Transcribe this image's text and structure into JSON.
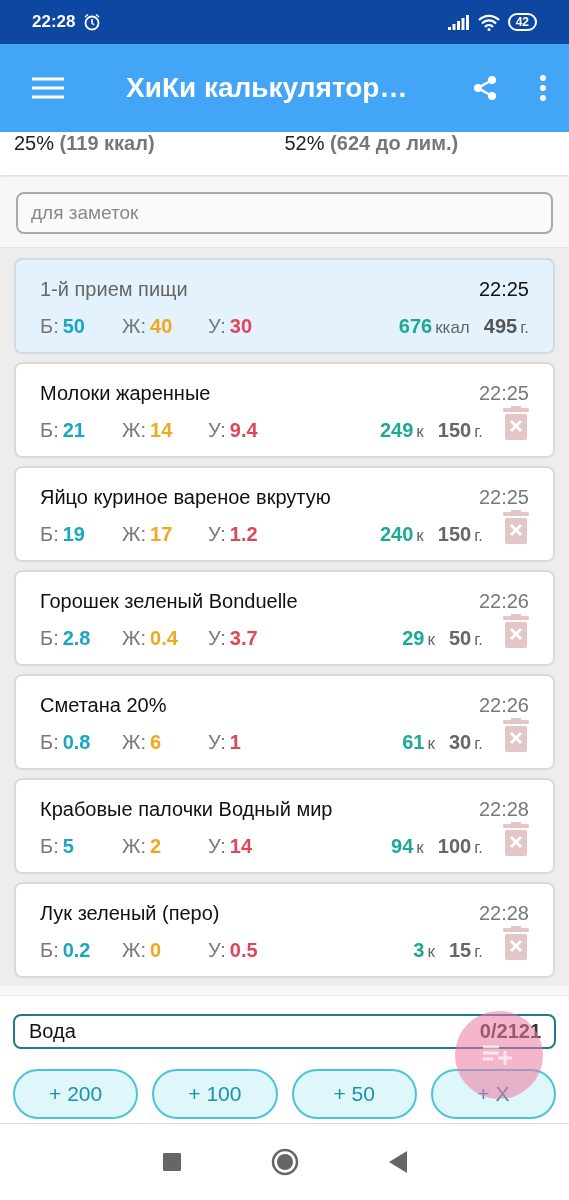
{
  "status_bar": {
    "time": "22:28",
    "battery": "42"
  },
  "app_bar": {
    "title": "ХиКи калькулятор…"
  },
  "summary": [
    {
      "percent": "25%",
      "detail": "(119 ккал)"
    },
    {
      "percent": "52%",
      "detail": "(624 до лим.)"
    }
  ],
  "notes": {
    "placeholder": "для заметок"
  },
  "meal": {
    "name": "1-й прием пищи",
    "time": "22:25",
    "macros": [
      {
        "kind": "protein",
        "label": "Б:",
        "value": "50"
      },
      {
        "kind": "fat",
        "label": "Ж:",
        "value": "40"
      },
      {
        "kind": "carbs",
        "label": "У:",
        "value": "30"
      }
    ],
    "kcal": "676",
    "kcal_unit": "ккал",
    "weight": "495",
    "weight_unit": "г."
  },
  "foods": [
    {
      "name": "Молоки жаренные",
      "time": "22:25",
      "macros": [
        {
          "kind": "protein",
          "label": "Б:",
          "value": "21"
        },
        {
          "kind": "fat",
          "label": "Ж:",
          "value": "14"
        },
        {
          "kind": "carbs",
          "label": "У:",
          "value": "9.4"
        }
      ],
      "kcal": "249",
      "kcal_unit": "к",
      "weight": "150",
      "weight_unit": "г."
    },
    {
      "name": "Яйцо куриное вареное вкрутую",
      "time": "22:25",
      "macros": [
        {
          "kind": "protein",
          "label": "Б:",
          "value": "19"
        },
        {
          "kind": "fat",
          "label": "Ж:",
          "value": "17"
        },
        {
          "kind": "carbs",
          "label": "У:",
          "value": "1.2"
        }
      ],
      "kcal": "240",
      "kcal_unit": "к",
      "weight": "150",
      "weight_unit": "г."
    },
    {
      "name": "Горошек зеленый Bonduelle",
      "time": "22:26",
      "macros": [
        {
          "kind": "protein",
          "label": "Б:",
          "value": "2.8"
        },
        {
          "kind": "fat",
          "label": "Ж:",
          "value": "0.4"
        },
        {
          "kind": "carbs",
          "label": "У:",
          "value": "3.7"
        }
      ],
      "kcal": "29",
      "kcal_unit": "к",
      "weight": "50",
      "weight_unit": "г."
    },
    {
      "name": "Сметана 20%",
      "time": "22:26",
      "macros": [
        {
          "kind": "protein",
          "label": "Б:",
          "value": "0.8"
        },
        {
          "kind": "fat",
          "label": "Ж:",
          "value": "6"
        },
        {
          "kind": "carbs",
          "label": "У:",
          "value": "1"
        }
      ],
      "kcal": "61",
      "kcal_unit": "к",
      "weight": "30",
      "weight_unit": "г."
    },
    {
      "name": "Крабовые палочки Водный мир",
      "time": "22:28",
      "macros": [
        {
          "kind": "protein",
          "label": "Б:",
          "value": "5"
        },
        {
          "kind": "fat",
          "label": "Ж:",
          "value": "2"
        },
        {
          "kind": "carbs",
          "label": "У:",
          "value": "14"
        }
      ],
      "kcal": "94",
      "kcal_unit": "к",
      "weight": "100",
      "weight_unit": "г."
    },
    {
      "name": "Лук зеленый (перо)",
      "time": "22:28",
      "macros": [
        {
          "kind": "protein",
          "label": "Б:",
          "value": "0.2"
        },
        {
          "kind": "fat",
          "label": "Ж:",
          "value": "0"
        },
        {
          "kind": "carbs",
          "label": "У:",
          "value": "0.5"
        }
      ],
      "kcal": "3",
      "kcal_unit": "к",
      "weight": "15",
      "weight_unit": "г."
    }
  ],
  "water": {
    "label": "Вода",
    "value": "0/2121",
    "buttons": [
      "+ 200",
      "+ 100",
      "+ 50",
      "+ X"
    ]
  }
}
